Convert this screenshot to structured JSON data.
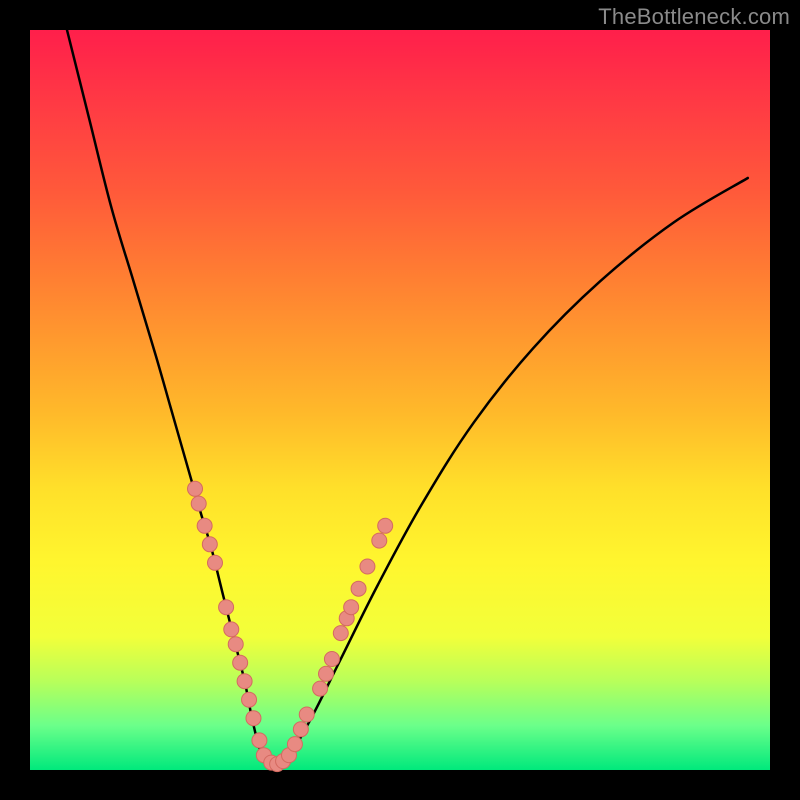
{
  "watermark": "TheBottleneck.com",
  "colors": {
    "frame": "#000000",
    "curve": "#000000",
    "marker_fill": "#e88a82",
    "marker_stroke": "#d46a60",
    "gradient_top": "#ff1f4b",
    "gradient_bottom": "#00e97c"
  },
  "chart_data": {
    "type": "line",
    "title": "",
    "xlabel": "",
    "ylabel": "",
    "xlim": [
      0,
      100
    ],
    "ylim": [
      0,
      100
    ],
    "grid": false,
    "legend": false,
    "series": [
      {
        "name": "curve",
        "x": [
          5,
          8,
          11,
          14,
          17,
          19,
          21,
          23,
          24.5,
          26,
          27.5,
          29,
          30,
          31,
          32,
          33,
          34.5,
          38,
          42,
          47,
          53,
          60,
          68,
          77,
          87,
          97
        ],
        "y": [
          100,
          88,
          76,
          66,
          56,
          49,
          42,
          35,
          30,
          24,
          18,
          12,
          7,
          3,
          1,
          0.5,
          1,
          7,
          15,
          25,
          36,
          47,
          57,
          66,
          74,
          80
        ]
      }
    ],
    "markers": [
      {
        "x": 22.3,
        "y": 38.0
      },
      {
        "x": 22.8,
        "y": 36.0
      },
      {
        "x": 23.6,
        "y": 33.0
      },
      {
        "x": 24.3,
        "y": 30.5
      },
      {
        "x": 25.0,
        "y": 28.0
      },
      {
        "x": 26.5,
        "y": 22.0
      },
      {
        "x": 27.2,
        "y": 19.0
      },
      {
        "x": 27.8,
        "y": 17.0
      },
      {
        "x": 28.4,
        "y": 14.5
      },
      {
        "x": 29.0,
        "y": 12.0
      },
      {
        "x": 29.6,
        "y": 9.5
      },
      {
        "x": 30.2,
        "y": 7.0
      },
      {
        "x": 31.0,
        "y": 4.0
      },
      {
        "x": 31.6,
        "y": 2.0
      },
      {
        "x": 32.6,
        "y": 1.0
      },
      {
        "x": 33.4,
        "y": 0.8
      },
      {
        "x": 34.2,
        "y": 1.2
      },
      {
        "x": 35.0,
        "y": 2.0
      },
      {
        "x": 35.8,
        "y": 3.5
      },
      {
        "x": 36.6,
        "y": 5.5
      },
      {
        "x": 37.4,
        "y": 7.5
      },
      {
        "x": 39.2,
        "y": 11.0
      },
      {
        "x": 40.0,
        "y": 13.0
      },
      {
        "x": 40.8,
        "y": 15.0
      },
      {
        "x": 42.0,
        "y": 18.5
      },
      {
        "x": 42.8,
        "y": 20.5
      },
      {
        "x": 43.4,
        "y": 22.0
      },
      {
        "x": 44.4,
        "y": 24.5
      },
      {
        "x": 45.6,
        "y": 27.5
      },
      {
        "x": 47.2,
        "y": 31.0
      },
      {
        "x": 48.0,
        "y": 33.0
      }
    ]
  }
}
